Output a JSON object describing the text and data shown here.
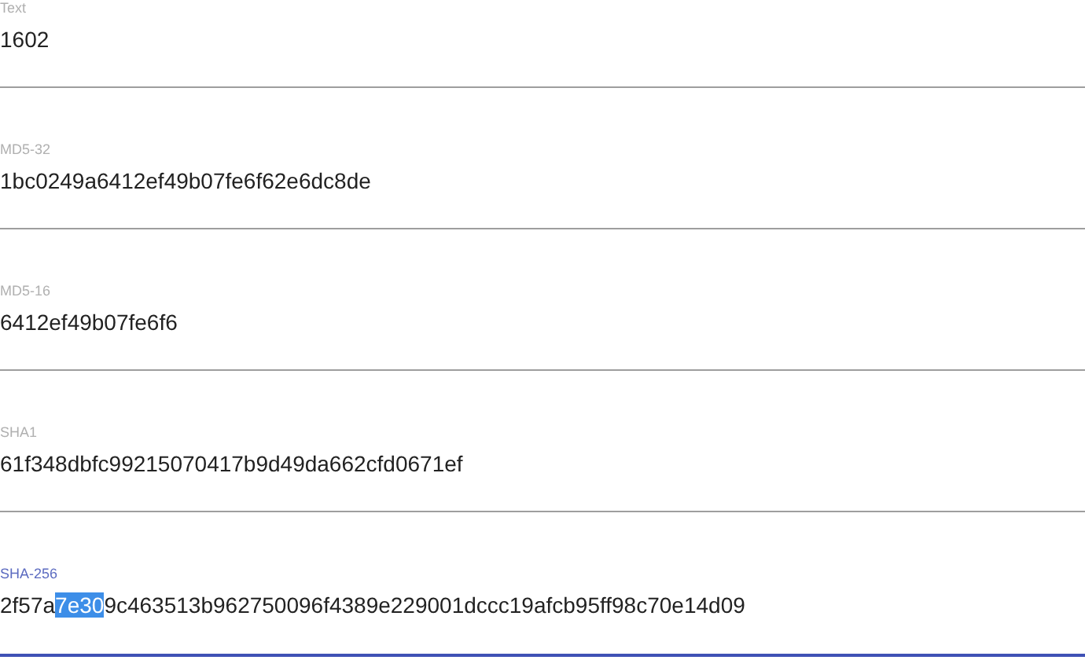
{
  "fields": [
    {
      "label": "Text",
      "value": "1602",
      "focused": false
    },
    {
      "label": "MD5-32",
      "value": "1bc0249a6412ef49b07fe6f62e6dc8de",
      "focused": false
    },
    {
      "label": "MD5-16",
      "value": "6412ef49b07fe6f6",
      "focused": false
    },
    {
      "label": "SHA1",
      "value": "61f348dbfc99215070417b9d49da662cfd0671ef",
      "focused": false
    },
    {
      "label": "SHA-256",
      "value": "2f57a",
      "selected_text": "7e30",
      "value_after": "9c463513b962750096f4389e229001dccc19afcb95ff98c70e14d09",
      "focused": true
    }
  ]
}
